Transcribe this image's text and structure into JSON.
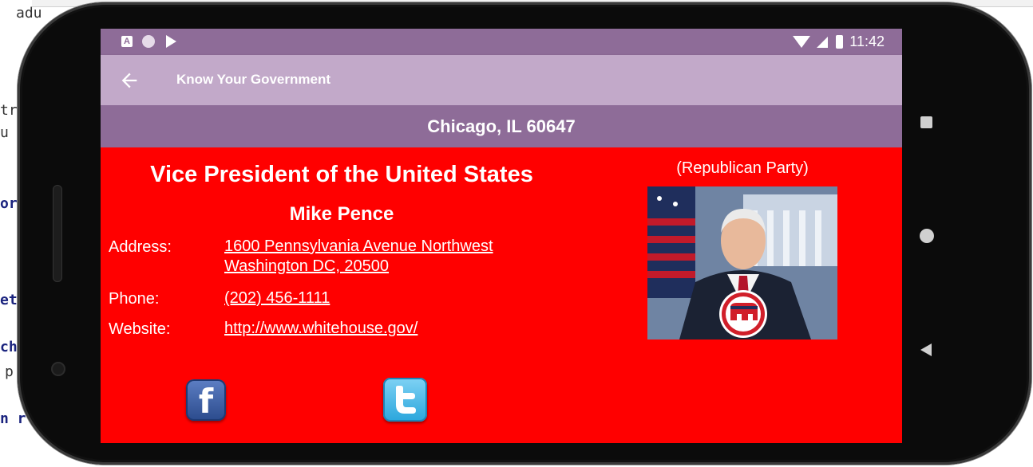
{
  "background": {
    "snippets": [
      "adu",
      "tri",
      "u G",
      "or",
      "etu",
      "ch",
      "p",
      "n r"
    ]
  },
  "status_bar": {
    "time": "11:42",
    "icons": [
      "a-notification-icon",
      "circle-icon",
      "play-icon",
      "wifi-icon",
      "signal-icon",
      "battery-icon"
    ]
  },
  "app_bar": {
    "title": "Know Your Government",
    "back_icon": "arrow-back-icon"
  },
  "location": "Chicago, IL 60647",
  "official": {
    "office": "Vice President of the United States",
    "name": "Mike Pence",
    "party": "(Republican Party)",
    "address_label": "Address:",
    "address_line1": "1600 Pennsylvania Avenue Northwest",
    "address_line2": "Washington DC, 20500",
    "phone_label": "Phone:",
    "phone": "(202) 456-1111",
    "website_label": "Website:",
    "website": "http://www.whitehouse.gov/"
  },
  "social": {
    "facebook_icon": "facebook-icon",
    "facebook_glyph": "f",
    "twitter_icon": "twitter-icon"
  },
  "colors": {
    "panel_background": "#ff0000",
    "status_bar": "#8e6c98",
    "app_bar": "#c2a9c9",
    "location_bar": "#8e6c98"
  }
}
